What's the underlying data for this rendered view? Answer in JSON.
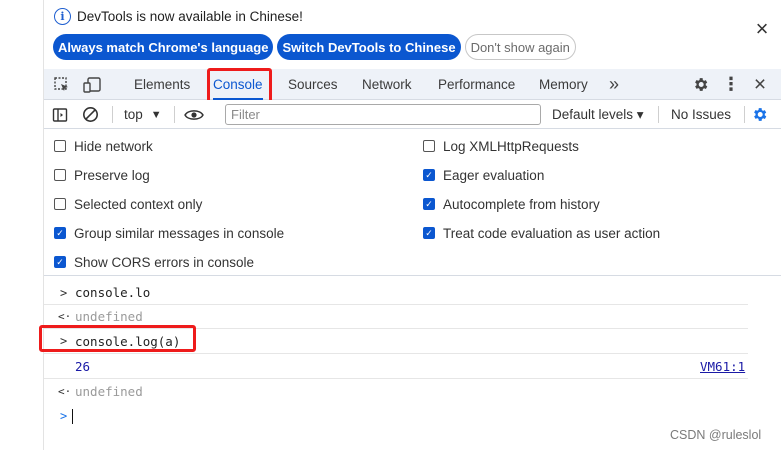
{
  "banner": {
    "message": "DevTools is now available in Chinese!",
    "buttons": {
      "match_language": "Always match Chrome's language",
      "switch_chinese": "Switch DevTools to Chinese",
      "dont_show": "Don't show again"
    },
    "close_glyph": "×"
  },
  "tabbar": {
    "tabs": [
      "Elements",
      "Console",
      "Sources",
      "Network",
      "Performance",
      "Memory"
    ],
    "active_tab": "Console",
    "overflow_glyph": "»",
    "more_glyph": "⋮",
    "close_glyph": "×"
  },
  "console_toolbar": {
    "context": "top",
    "filter_placeholder": "Filter",
    "levels": "Default levels ▾",
    "issues": "No Issues"
  },
  "settings": {
    "left": [
      {
        "label": "Hide network",
        "checked": false
      },
      {
        "label": "Preserve log",
        "checked": false
      },
      {
        "label": "Selected context only",
        "checked": false
      },
      {
        "label": "Group similar messages in console",
        "checked": true
      },
      {
        "label": "Show CORS errors in console",
        "checked": true
      }
    ],
    "right": [
      {
        "label": "Log XMLHttpRequests",
        "checked": false
      },
      {
        "label": "Eager evaluation",
        "checked": true
      },
      {
        "label": "Autocomplete from history",
        "checked": true
      },
      {
        "label": "Treat code evaluation as user action",
        "checked": true
      }
    ]
  },
  "console": {
    "entries": [
      {
        "prompt": ">",
        "text": "console.lo"
      },
      {
        "prompt": "<·",
        "text": "undefined"
      },
      {
        "prompt": ">",
        "text": "console.log(a)"
      },
      {
        "prompt": "",
        "text": "26",
        "source": "VM61:1"
      },
      {
        "prompt": "<·",
        "text": "undefined"
      }
    ],
    "input_prompt": ">"
  },
  "watermark": "CSDN @ruleslol",
  "colors": {
    "accent": "#0b57d0",
    "highlight": "#ee1b1b",
    "tabbar_bg": "#eef2f8"
  }
}
